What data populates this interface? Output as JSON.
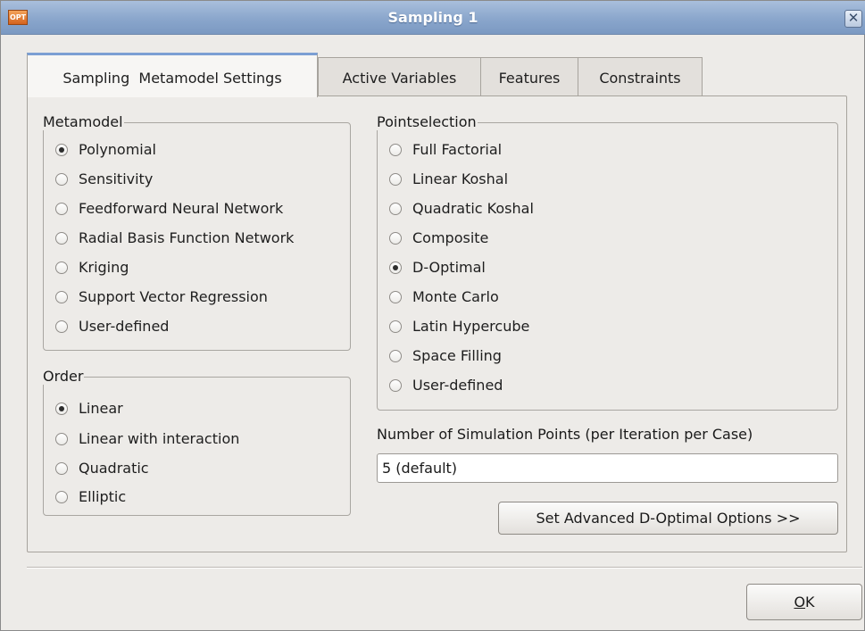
{
  "window": {
    "title": "Sampling 1",
    "app_icon_text": "OPT",
    "close_symbol": "✕"
  },
  "tabs": [
    {
      "label": "Sampling  Metamodel Settings",
      "active": true
    },
    {
      "label": "Active Variables",
      "active": false
    },
    {
      "label": "Features",
      "active": false
    },
    {
      "label": "Constraints",
      "active": false
    }
  ],
  "metamodel": {
    "legend": "Metamodel",
    "options": [
      {
        "label": "Polynomial",
        "selected": true
      },
      {
        "label": "Sensitivity",
        "selected": false
      },
      {
        "label": "Feedforward Neural Network",
        "selected": false
      },
      {
        "label": "Radial Basis Function Network",
        "selected": false
      },
      {
        "label": "Kriging",
        "selected": false
      },
      {
        "label": "Support Vector Regression",
        "selected": false
      },
      {
        "label": "User-defined",
        "selected": false
      }
    ]
  },
  "order": {
    "legend": "Order",
    "options": [
      {
        "label": "Linear",
        "selected": true
      },
      {
        "label": "Linear with interaction",
        "selected": false
      },
      {
        "label": "Quadratic",
        "selected": false
      },
      {
        "label": "Elliptic",
        "selected": false
      }
    ]
  },
  "pointselection": {
    "legend": "Pointselection",
    "options": [
      {
        "label": "Full Factorial",
        "selected": false
      },
      {
        "label": "Linear Koshal",
        "selected": false
      },
      {
        "label": "Quadratic Koshal",
        "selected": false
      },
      {
        "label": "Composite",
        "selected": false
      },
      {
        "label": "D-Optimal",
        "selected": true
      },
      {
        "label": "Monte Carlo",
        "selected": false
      },
      {
        "label": "Latin Hypercube",
        "selected": false
      },
      {
        "label": "Space Filling",
        "selected": false
      },
      {
        "label": "User-defined",
        "selected": false
      }
    ]
  },
  "simulation_points": {
    "label": "Number of Simulation Points (per Iteration per Case)",
    "value": "5 (default)"
  },
  "buttons": {
    "advanced": "Set Advanced D-Optimal Options >>",
    "ok_mnemonic": "O",
    "ok_rest": "K"
  }
}
